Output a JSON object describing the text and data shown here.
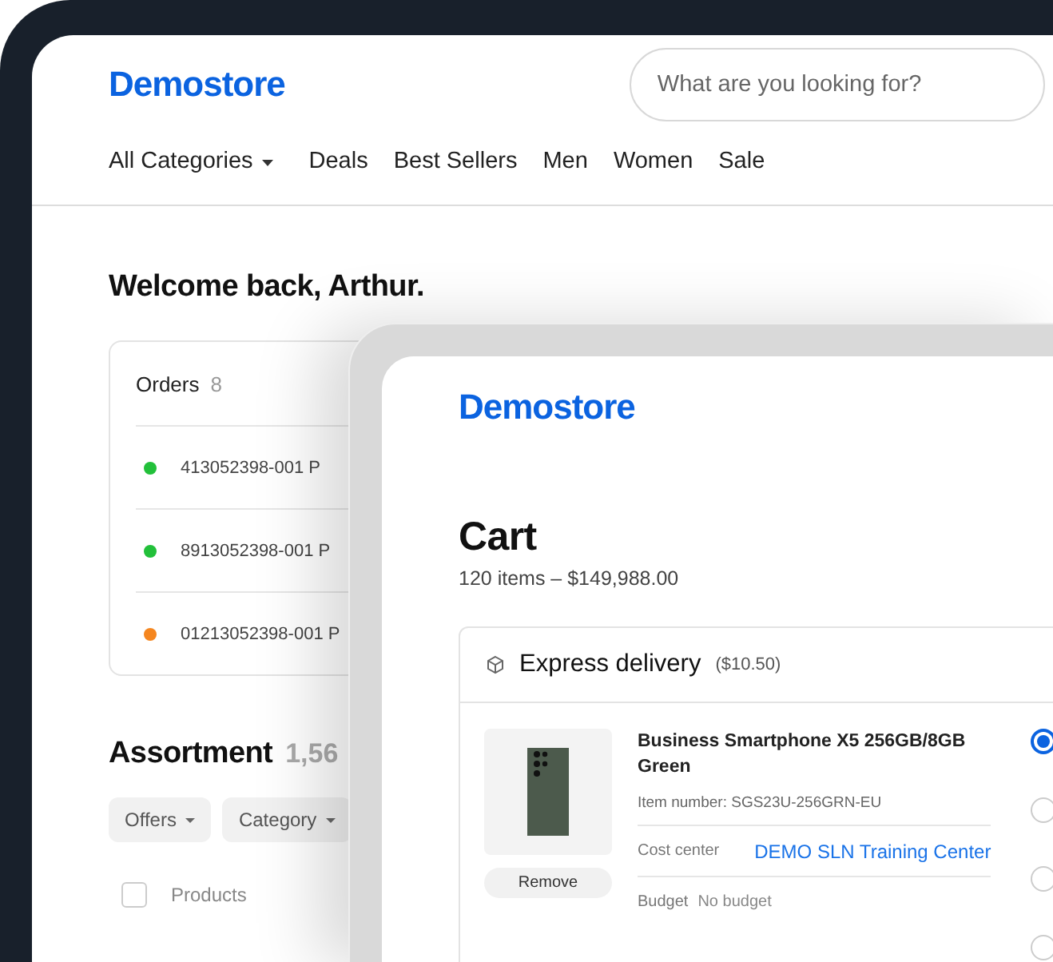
{
  "back_screen": {
    "logo": "Demostore",
    "search": {
      "placeholder": "What are you looking for?"
    },
    "nav": [
      {
        "label": "All Categories",
        "dropdown": true
      },
      {
        "label": "Deals",
        "dropdown": false
      },
      {
        "label": "Best Sellers",
        "dropdown": false
      },
      {
        "label": "Men",
        "dropdown": false
      },
      {
        "label": "Women",
        "dropdown": false
      },
      {
        "label": "Sale",
        "dropdown": false
      }
    ],
    "welcome": "Welcome back, Arthur.",
    "orders": {
      "title": "Orders",
      "count": "8",
      "rows": [
        {
          "id": "413052398-001 P",
          "color": "#22c03a"
        },
        {
          "id": "8913052398-001 P",
          "color": "#22c03a"
        },
        {
          "id": "01213052398-001 P",
          "color": "#f5861f"
        }
      ]
    },
    "assortment": {
      "title": "Assortment",
      "count": "1,56",
      "filters": [
        {
          "label": "Offers"
        },
        {
          "label": "Category"
        }
      ],
      "table": {
        "columns": [
          {
            "label": "Products",
            "checked": false
          }
        ]
      }
    }
  },
  "front_screen": {
    "logo": "Demostore",
    "title": "Cart",
    "summary": "120 items – $149,988.00",
    "delivery": {
      "title": "Express delivery",
      "price": "($10.50)",
      "item": {
        "name": "Business Smartphone X5 256GB/8GB Green",
        "item_number": "Item number: SGS23U-256GRN-EU",
        "remove": "Remove",
        "cost_center_label": "Cost center",
        "cost_center": "DEMO SLN Training Center",
        "budget_label": "Budget",
        "budget": "No budget"
      },
      "options": [
        {
          "selected": true
        },
        {
          "selected": false
        },
        {
          "selected": false
        },
        {
          "selected": false
        }
      ]
    }
  }
}
